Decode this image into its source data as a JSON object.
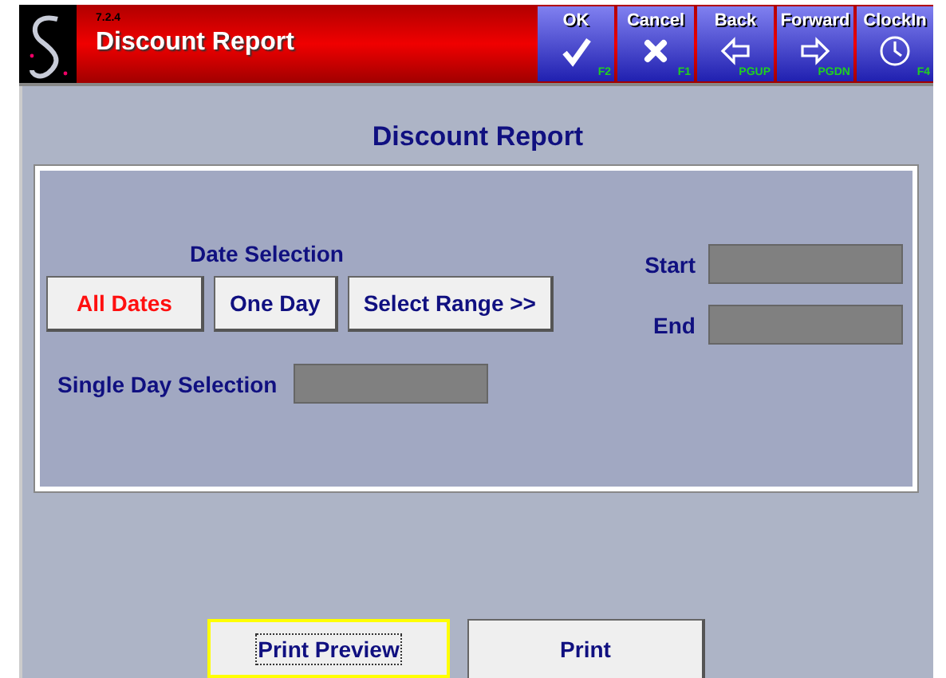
{
  "header": {
    "version": "7.2.4",
    "title": "Discount Report"
  },
  "toolbar": [
    {
      "label": "OK",
      "key": "F2"
    },
    {
      "label": "Cancel",
      "key": "F1"
    },
    {
      "label": "Back",
      "key": "PGUP"
    },
    {
      "label": "Forward",
      "key": "PGDN"
    },
    {
      "label": "ClockIn",
      "key": "F4"
    }
  ],
  "page_title": "Discount Report",
  "date_selection": {
    "label": "Date Selection",
    "options": [
      {
        "label": "All Dates",
        "selected": true
      },
      {
        "label": "One Day",
        "selected": false
      },
      {
        "label": "Select Range >>",
        "selected": false
      }
    ]
  },
  "range": {
    "start_label": "Start",
    "end_label": "End"
  },
  "single_day": {
    "label": "Single Day Selection"
  },
  "actions": [
    {
      "label": "Print Preview",
      "focused": true
    },
    {
      "label": "Print",
      "focused": false
    }
  ]
}
